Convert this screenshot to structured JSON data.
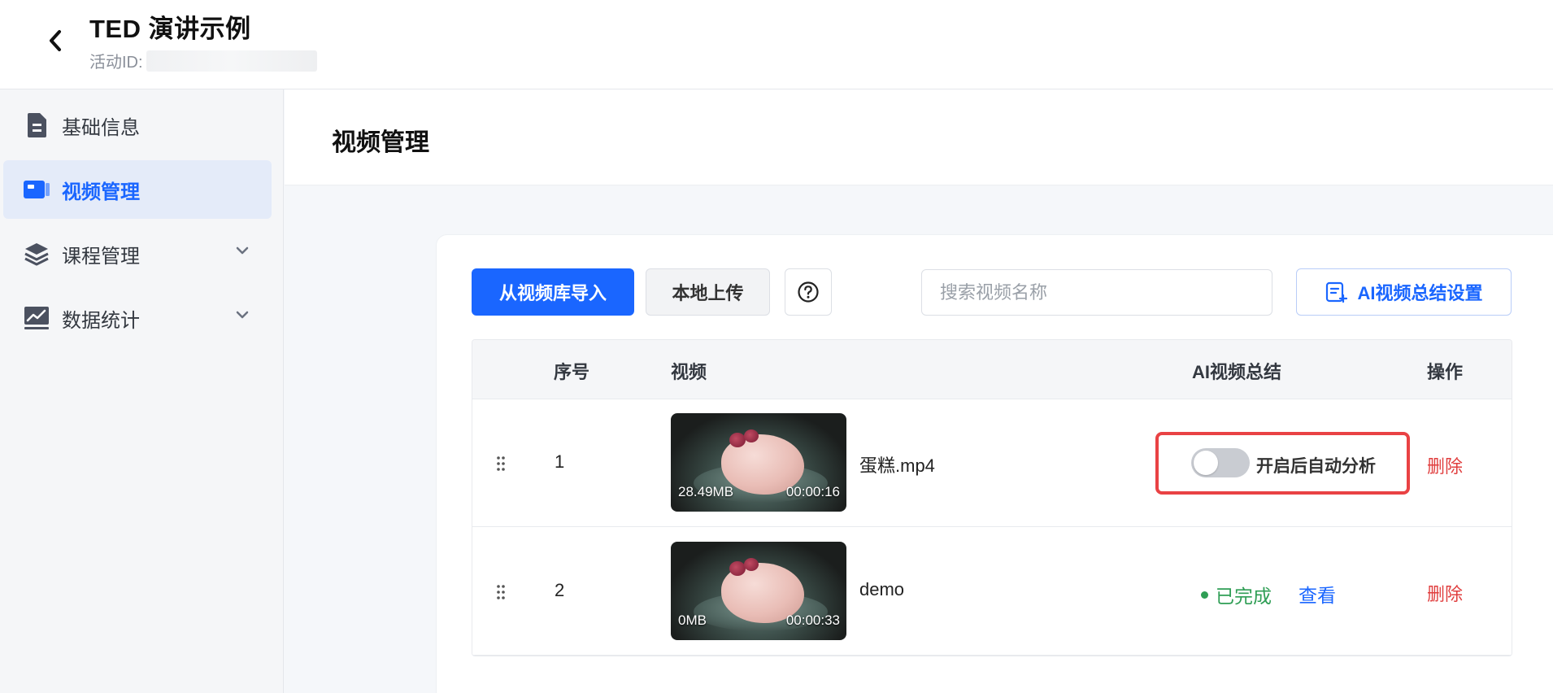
{
  "header": {
    "title": "TED 演讲示例",
    "activity_id_label": "活动ID:"
  },
  "sidebar": {
    "items": [
      {
        "label": "基础信息",
        "icon": "document-icon"
      },
      {
        "label": "视频管理",
        "icon": "video-icon",
        "active": true
      },
      {
        "label": "课程管理",
        "icon": "layers-icon",
        "expandable": true
      },
      {
        "label": "数据统计",
        "icon": "chart-icon",
        "expandable": true
      }
    ]
  },
  "main": {
    "section_title": "视频管理",
    "toolbar": {
      "import_label": "从视频库导入",
      "upload_label": "本地上传",
      "search_placeholder": "搜索视频名称",
      "ai_settings_label": "AI视频总结设置"
    },
    "table": {
      "columns": [
        "序号",
        "视频",
        "AI视频总结",
        "操作"
      ],
      "rows": [
        {
          "index": "1",
          "size": "28.49MB",
          "duration": "00:00:16",
          "name": "蛋糕.mp4",
          "toggle_label": "开启后自动分析",
          "toggle_on": false,
          "delete": "删除"
        },
        {
          "index": "2",
          "size": "0MB",
          "duration": "00:00:33",
          "name": "demo",
          "status": "已完成",
          "view": "查看",
          "delete": "删除"
        }
      ]
    }
  },
  "colors": {
    "primary": "#1a66ff",
    "danger": "#e03e3e",
    "success": "#2f9e55",
    "highlight_border": "#e94244"
  }
}
